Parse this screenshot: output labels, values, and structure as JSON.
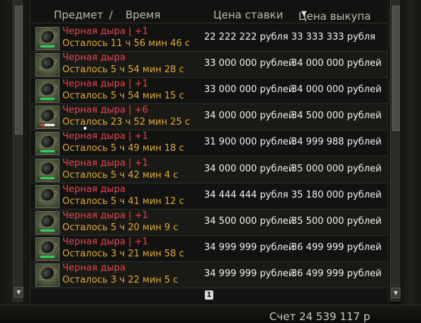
{
  "header": {
    "item": "Предмет",
    "separator": "/",
    "time": "Время",
    "bid": "Цена ставки",
    "buyout": "Цена выкупа",
    "sort_icon": "triangle-down-icon"
  },
  "rows": [
    {
      "name": "Черная дыра | +1",
      "time": "Осталось 11 ч 56 мин 46 с",
      "bid": "22 222 222 рубля",
      "buyout": "33 333 333 рубля",
      "icon": "black-hole-icon"
    },
    {
      "name": "Черная дыра",
      "time": "Осталось 5 ч 54 мин 28 с",
      "bid": "33 000 000 рублей",
      "buyout": "34 000 000 рублей",
      "icon": "black-hole-icon"
    },
    {
      "name": "Черная дыра | +1",
      "time": "Осталось 5 ч 54 мин 15 с",
      "bid": "33 000 000 рублей",
      "buyout": "34 000 000 рублей",
      "icon": "black-hole-icon"
    },
    {
      "name": "Черная дыра | +6",
      "time": "Осталось 23 ч 52 мин 25 с",
      "bid": "34 000 000 рублей",
      "buyout": "34 500 000 рублей",
      "icon": "black-hole-icon"
    },
    {
      "name": "Черная дыра | +1",
      "time": "Осталось 5 ч 49 мин 18 с",
      "bid": "31 900 000 рублей",
      "buyout": "34 999 988 рублей",
      "icon": "black-hole-icon"
    },
    {
      "name": "Черная дыра | +1",
      "time": "Осталось 5 ч 42 мин 4 с",
      "bid": "34 000 000 рублей",
      "buyout": "35 000 000 рублей",
      "icon": "black-hole-icon"
    },
    {
      "name": "Черная дыра",
      "time": "Осталось 5 ч 41 мин 12 с",
      "bid": "34 444 444 рубля",
      "buyout": "35 180 000 рублей",
      "icon": "black-hole-icon"
    },
    {
      "name": "Черная дыра | +1",
      "time": "Осталось 5 ч 20 мин 9 с",
      "bid": "34 500 000 рублей",
      "buyout": "35 500 000 рублей",
      "icon": "black-hole-icon"
    },
    {
      "name": "Черная дыра | +1",
      "time": "Осталось 3 ч 21 мин 58 с",
      "bid": "34 999 999 рублей",
      "buyout": "36 499 999 рублей",
      "icon": "black-hole-icon"
    },
    {
      "name": "Черная дыра",
      "time": "Осталось 3 ч 22 мин 5 с",
      "bid": "34 999 999 рублей",
      "buyout": "36 499 999 рублей",
      "icon": "black-hole-icon"
    }
  ],
  "pagination": {
    "current_page": "1"
  },
  "footer": {
    "text": "Счет 24 539 117 р"
  },
  "colors": {
    "item_name": "#e8434f",
    "time_left": "#e0a83a",
    "price": "#f1f1f1",
    "header": "#b9b9b3"
  }
}
